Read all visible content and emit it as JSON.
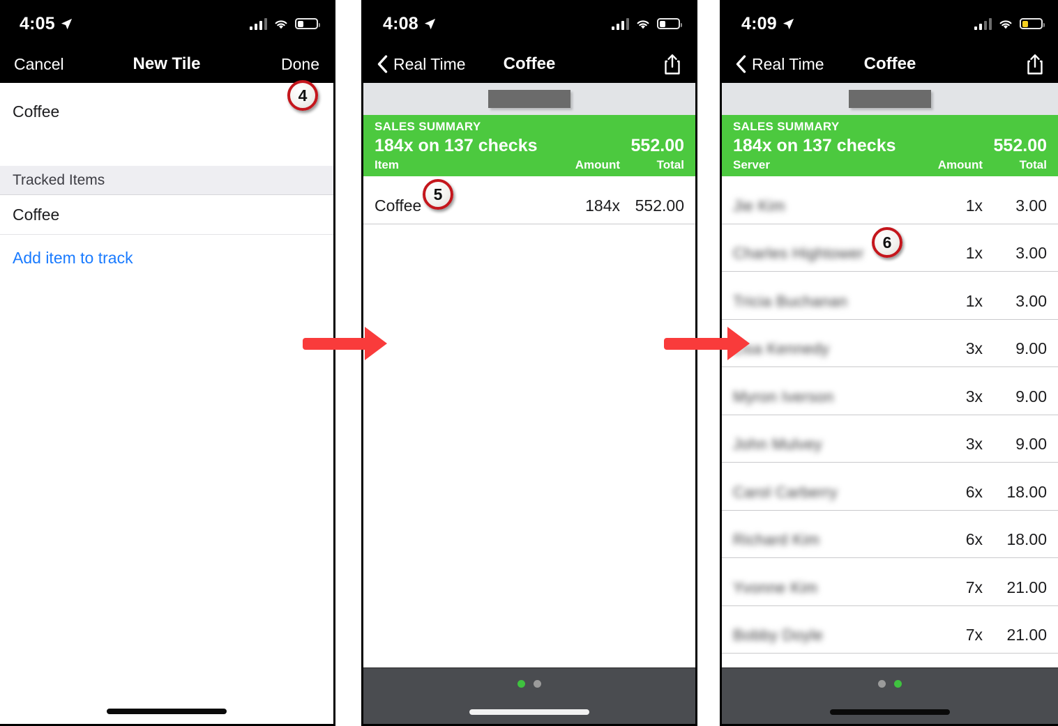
{
  "panels": [
    {
      "id": "new-tile",
      "status": {
        "time": "4:05",
        "location_icon": "location-arrow-icon",
        "signal_bars": 3,
        "wifi": "wifi-icon",
        "battery": "battery-low-icon",
        "battery_color": "#ffffff"
      },
      "nav": {
        "left": "Cancel",
        "title": "New Tile",
        "right": "Done"
      },
      "form": {
        "tile_name": "Coffee",
        "section_header": "Tracked Items",
        "tracked_items": [
          "Coffee"
        ],
        "add_link": "Add item to track"
      },
      "badge": "4"
    },
    {
      "id": "coffee-by-item",
      "status": {
        "time": "4:08",
        "location_icon": "location-arrow-icon",
        "signal_bars": 3,
        "wifi": "wifi-icon",
        "battery": "battery-low-icon",
        "battery_color": "#ffffff"
      },
      "nav": {
        "back": "Real Time",
        "title": "Coffee",
        "share": "share-icon"
      },
      "summary": {
        "label": "SALES SUMMARY",
        "headline": "184x on 137 checks",
        "total": "552.00",
        "columns": {
          "name": "Item",
          "amount": "Amount",
          "total": "Total"
        }
      },
      "rows": [
        {
          "name": "Coffee",
          "redacted": false,
          "amount": "184x",
          "total": "552.00"
        }
      ],
      "dots": {
        "count": 2,
        "active": 0
      },
      "badge": "5"
    },
    {
      "id": "coffee-by-server",
      "status": {
        "time": "4:09",
        "location_icon": "location-arrow-icon",
        "signal_bars": 2,
        "wifi": "wifi-icon",
        "battery": "battery-low-power-icon",
        "battery_color": "#f5d020"
      },
      "nav": {
        "back": "Real Time",
        "title": "Coffee",
        "share": "share-icon"
      },
      "summary": {
        "label": "SALES SUMMARY",
        "headline": "184x on 137 checks",
        "total": "552.00",
        "columns": {
          "name": "Server",
          "amount": "Amount",
          "total": "Total"
        }
      },
      "rows": [
        {
          "name": "Jie Kim",
          "redacted": true,
          "amount": "1x",
          "total": "3.00"
        },
        {
          "name": "Charles Hightower",
          "redacted": true,
          "amount": "1x",
          "total": "3.00"
        },
        {
          "name": "Tricia Buchanan",
          "redacted": true,
          "amount": "1x",
          "total": "3.00"
        },
        {
          "name": "Lisa Kennedy",
          "redacted": true,
          "amount": "3x",
          "total": "9.00"
        },
        {
          "name": "Myron Iverson",
          "redacted": true,
          "amount": "3x",
          "total": "9.00"
        },
        {
          "name": "John Mulvey",
          "redacted": true,
          "amount": "3x",
          "total": "9.00"
        },
        {
          "name": "Carol Carberry",
          "redacted": true,
          "amount": "6x",
          "total": "18.00"
        },
        {
          "name": "Richard Kim",
          "redacted": true,
          "amount": "6x",
          "total": "18.00"
        },
        {
          "name": "Yvonne Kim",
          "redacted": true,
          "amount": "7x",
          "total": "21.00"
        },
        {
          "name": "Bobby Doyle",
          "redacted": true,
          "amount": "7x",
          "total": "21.00"
        }
      ],
      "dots": {
        "count": 2,
        "active": 1
      },
      "badge": "6"
    }
  ],
  "annotations": {
    "arrows": [
      "arrow-right",
      "arrow-right"
    ],
    "arrow_color": "#f93b3b",
    "badge_ring_color": "#c4161c"
  },
  "colors": {
    "summary_green": "#4cc93f",
    "dock_gray": "#4a4c50",
    "active_dot_green": "#3fc23f",
    "link_blue": "#1a7bff"
  }
}
